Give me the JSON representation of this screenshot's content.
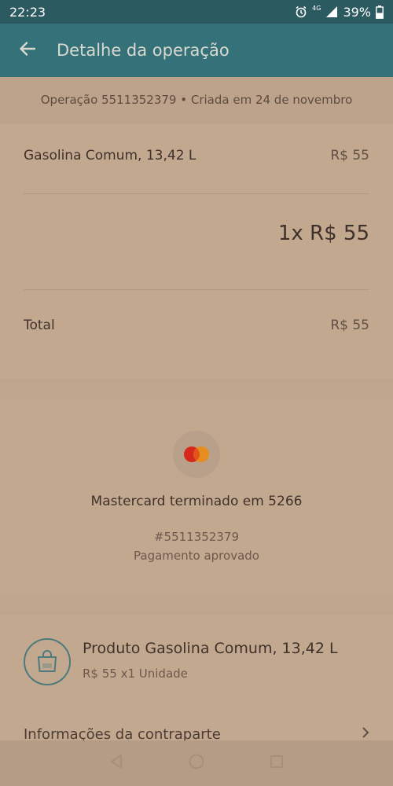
{
  "status_bar": {
    "time": "22:23",
    "network": "4G",
    "battery": "39%"
  },
  "app_bar": {
    "title": "Detalhe da operação"
  },
  "operation": {
    "summary": "Operação 5511352379 • Criada em 24 de novembro"
  },
  "items": {
    "name": "Gasolina Comum, 13,42 L",
    "price": "R$ 55",
    "quantity_amount": "1x R$ 55",
    "total_label": "Total",
    "total_value": "R$ 55"
  },
  "payment": {
    "card_label": "Mastercard terminado em 5266",
    "reference": "#5511352379",
    "status": "Pagamento aprovado",
    "colors": {
      "red": "#d6291d",
      "orange": "#e88c1a"
    }
  },
  "product": {
    "title": "Produto Gasolina Comum, 13,42 L",
    "subtitle": "R$ 55 x1 Unidade"
  },
  "counterpart": {
    "label": "Informações da contraparte"
  },
  "icons": {
    "back": "arrow-left-icon",
    "alarm": "alarm-icon",
    "signal": "signal-icon",
    "battery": "battery-icon",
    "bag": "shopping-bag-icon",
    "chevron": "chevron-right-icon"
  }
}
